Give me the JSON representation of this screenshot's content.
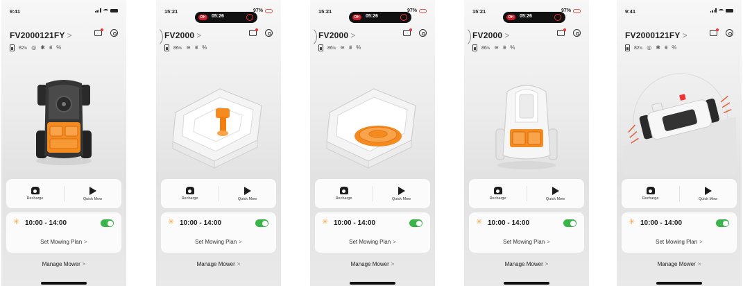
{
  "colors": {
    "accent_orange": "#f58a1e",
    "toggle_green": "#3ab54a",
    "sun": "#f2a23c",
    "recording_red": "#d21d2a"
  },
  "icons": {
    "message": "message-icon",
    "settings": "settings-icon",
    "battery": "battery-icon",
    "status": [
      "signal-icon",
      "bluetooth-icon",
      "network-icon",
      "rtk-icon"
    ],
    "recharge": "home-recharge-icon",
    "quick_mow": "play-icon",
    "sun": "sun-icon",
    "chevron": "chevron-right-icon"
  },
  "screens": [
    {
      "status": {
        "time": "9:41",
        "recording": "",
        "recording_time": "",
        "battery_pct": ""
      },
      "device": {
        "name": "FV2000121FY",
        "chevron": ">"
      },
      "battery_pct": "82",
      "battery_unit": "%",
      "status_glyphs": [
        "◎",
        "✱",
        "⩩",
        "%"
      ],
      "actions": {
        "recharge_label": "Recharge",
        "quick_mow_label": "Quick Mow"
      },
      "plan": {
        "time": "10:00 - 14:00",
        "enabled": true,
        "link_label": "Set Mowing Plan",
        "chevron": ">"
      },
      "manage": {
        "label": "Manage Mower",
        "chevron": ">"
      }
    },
    {
      "status": {
        "time": "15:21",
        "recording": "DH",
        "recording_time": "05:26",
        "battery_pct": "97%"
      },
      "device": {
        "name": "FV2000",
        "chevron": ">"
      },
      "battery_pct": "86",
      "battery_unit": "%",
      "status_glyphs": [
        "≋",
        "⩩",
        "%"
      ],
      "actions": {
        "recharge_label": "Recharge",
        "quick_mow_label": "Quick Mow"
      },
      "plan": {
        "time": "10:00 - 14:00",
        "enabled": true,
        "link_label": "Set Mowing Plan",
        "chevron": ">"
      },
      "manage": {
        "label": "Manage Mower",
        "chevron": ">"
      }
    },
    {
      "status": {
        "time": "15:21",
        "recording": "DH",
        "recording_time": "05:26",
        "battery_pct": "97%"
      },
      "device": {
        "name": "FV2000",
        "chevron": ">"
      },
      "battery_pct": "86",
      "battery_unit": "%",
      "status_glyphs": [
        "≋",
        "⩩",
        "%"
      ],
      "actions": {
        "recharge_label": "Recharge",
        "quick_mow_label": "Quick Mow"
      },
      "plan": {
        "time": "10:00 - 14:00",
        "enabled": true,
        "link_label": "Set Mowing Plan",
        "chevron": ">"
      },
      "manage": {
        "label": "Manage Mower",
        "chevron": ">"
      }
    },
    {
      "status": {
        "time": "15:21",
        "recording": "DH",
        "recording_time": "05:26",
        "battery_pct": "97%"
      },
      "device": {
        "name": "FV2000",
        "chevron": ">"
      },
      "battery_pct": "86",
      "battery_unit": "%",
      "status_glyphs": [
        "≋",
        "⩩",
        "%"
      ],
      "actions": {
        "recharge_label": "Recharge",
        "quick_mow_label": "Quick Mow"
      },
      "plan": {
        "time": "10:00 - 14:00",
        "enabled": true,
        "link_label": "Set Mowing Plan",
        "chevron": ">"
      },
      "manage": {
        "label": "Manage Mower",
        "chevron": ">"
      }
    },
    {
      "status": {
        "time": "9:41",
        "recording": "",
        "recording_time": "",
        "battery_pct": ""
      },
      "device": {
        "name": "FV2000121FY",
        "chevron": ">"
      },
      "battery_pct": "82",
      "battery_unit": "%",
      "status_glyphs": [
        "◎",
        "✱",
        "⩩",
        "%"
      ],
      "actions": {
        "recharge_label": "Recharge",
        "quick_mow_label": "Quick Mow"
      },
      "plan": {
        "time": "10:00 - 14:00",
        "enabled": true,
        "link_label": "Set Mowing Plan",
        "chevron": ">"
      },
      "manage": {
        "label": "Manage Mower",
        "chevron": ">"
      }
    }
  ]
}
